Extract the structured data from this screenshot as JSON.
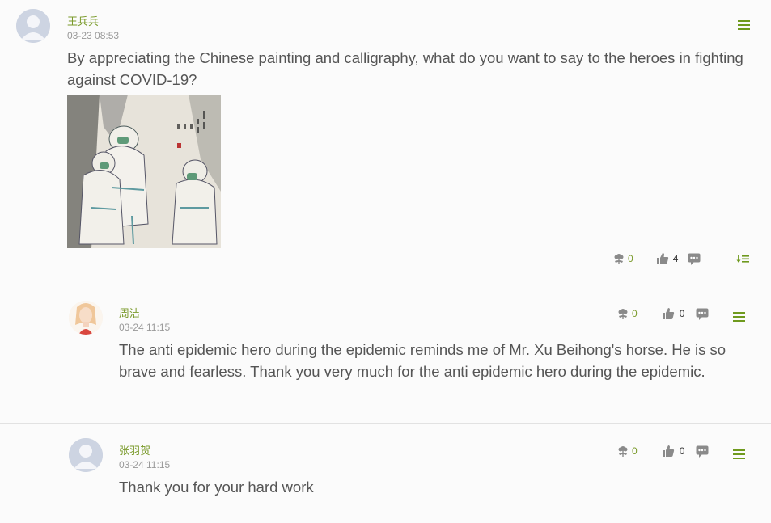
{
  "main_post": {
    "username": "王兵兵",
    "time": "03-23 08:53",
    "content": "By appreciating the Chinese painting and calligraphy, what do you want to say to the heroes in fighting against COVID-19?",
    "flower_count": "0",
    "like_count": "4",
    "icons": [
      "avatar-default",
      "flower-icon",
      "thumbs-up-icon",
      "comment-icon",
      "sort-icon",
      "menu-icon"
    ]
  },
  "replies": [
    {
      "username": "周洁",
      "time": "03-24 11:15",
      "content": "The anti epidemic hero during the epidemic reminds me of Mr. Xu Beihong's horse. He is so brave and fearless. Thank you very much for the anti epidemic hero during the epidemic.",
      "flower_count": "0",
      "like_count": "0"
    },
    {
      "username": "张羽贺",
      "time": "03-24 11:15",
      "content": "Thank you for your hard work",
      "flower_count": "0",
      "like_count": "0"
    }
  ],
  "colors": {
    "accent": "#7a9a2a",
    "menu": "#6f9a1e",
    "icon_gray": "#888888",
    "divider": "#e2e2e2"
  }
}
